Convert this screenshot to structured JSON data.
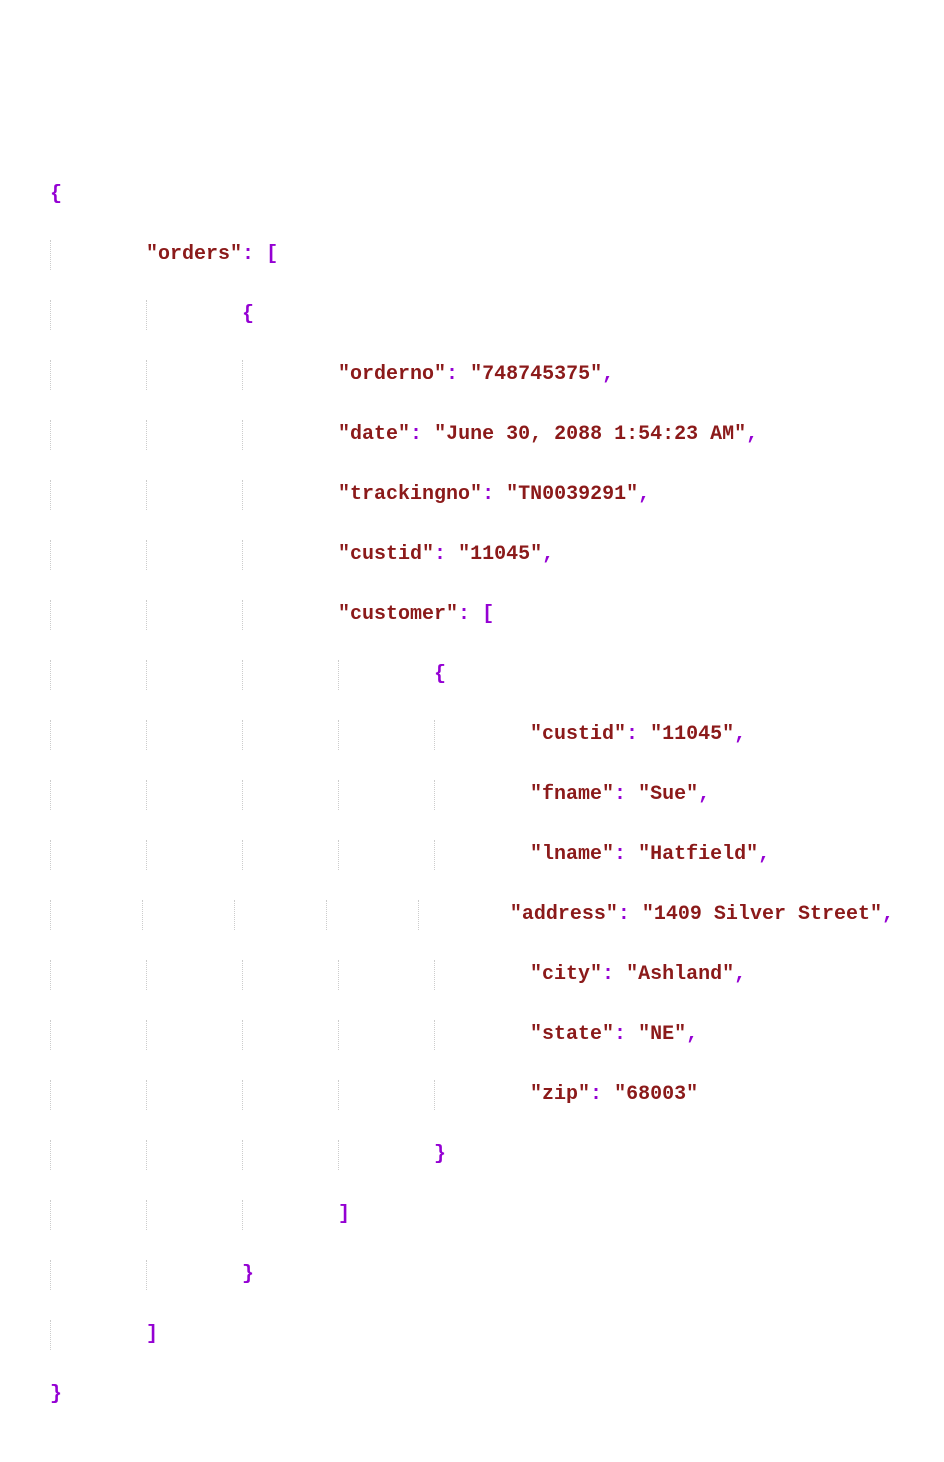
{
  "code": {
    "rootKey": "orders",
    "order": {
      "keys": {
        "orderno": "orderno",
        "date": "date",
        "trackingno": "trackingno",
        "custid": "custid",
        "customer": "customer"
      },
      "values": {
        "orderno": "748745375",
        "date": "June 30, 2088 1:54:23 AM",
        "trackingno": "TN0039291",
        "custid": "11045"
      }
    },
    "customer": {
      "keys": {
        "custid": "custid",
        "fname": "fname",
        "lname": "lname",
        "address": "address",
        "city": "city",
        "state": "state",
        "zip": "zip"
      },
      "values": {
        "custid": "11045",
        "fname": "Sue",
        "lname": "Hatfield",
        "address": "1409 Silver Street",
        "city": "Ashland",
        "state": "NE",
        "zip": "68003"
      }
    }
  }
}
